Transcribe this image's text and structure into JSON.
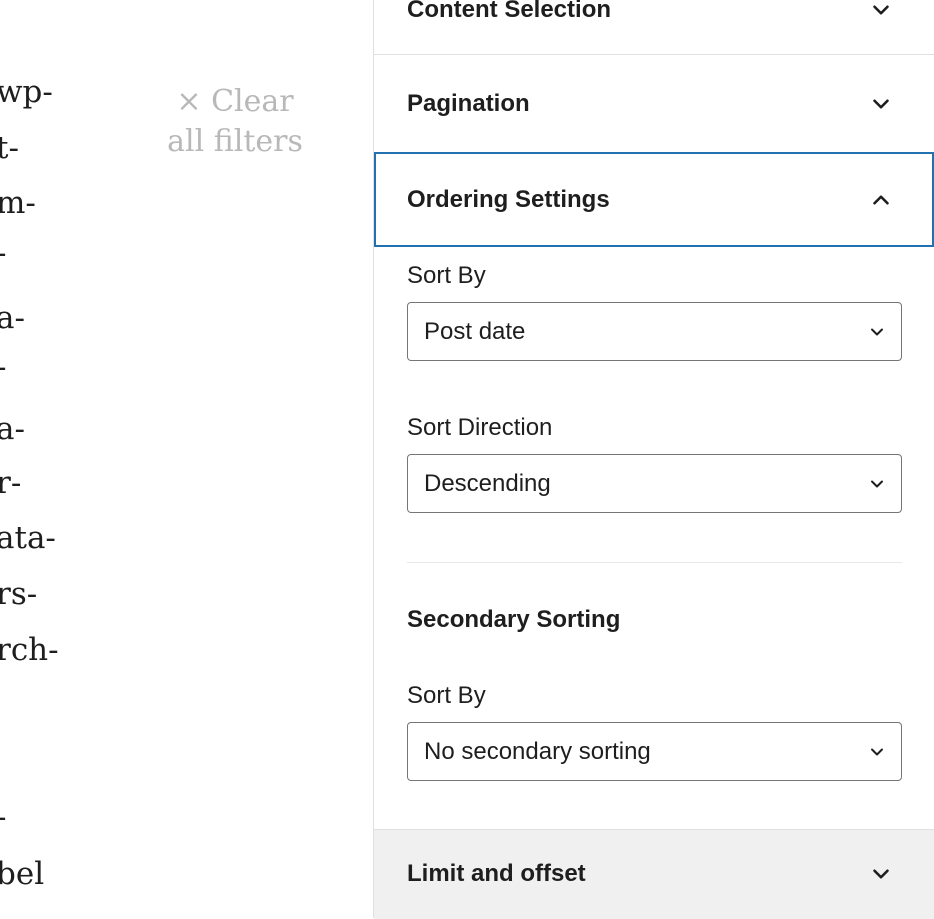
{
  "canvas": {
    "fragments": [
      "wp-",
      "t-",
      "m-",
      "-",
      "a-",
      "-",
      "a-",
      "r-",
      "ata-",
      "rs-",
      "rch-",
      "-",
      "bel"
    ],
    "clear_filters": "× Clear all filters"
  },
  "sidebar": {
    "panels": {
      "content_selection": "Content Selection",
      "pagination": "Pagination",
      "ordering_settings": "Ordering Settings",
      "limit_offset": "Limit and offset"
    },
    "ordering": {
      "sort_by_label": "Sort By",
      "sort_by_value": "Post date",
      "sort_direction_label": "Sort Direction",
      "sort_direction_value": "Descending",
      "secondary_heading": "Secondary Sorting",
      "secondary_sort_by_label": "Sort By",
      "secondary_sort_by_value": "No secondary sorting"
    }
  },
  "colors": {
    "focus_border": "#2271b1",
    "text": "#1e1e1e",
    "muted_text": "#b8b8b8",
    "footer_bg": "#f0f0f0"
  },
  "icons": {
    "collapsed": "chevron-down-icon",
    "expanded": "chevron-up-icon",
    "select": "chevron-down-icon"
  }
}
